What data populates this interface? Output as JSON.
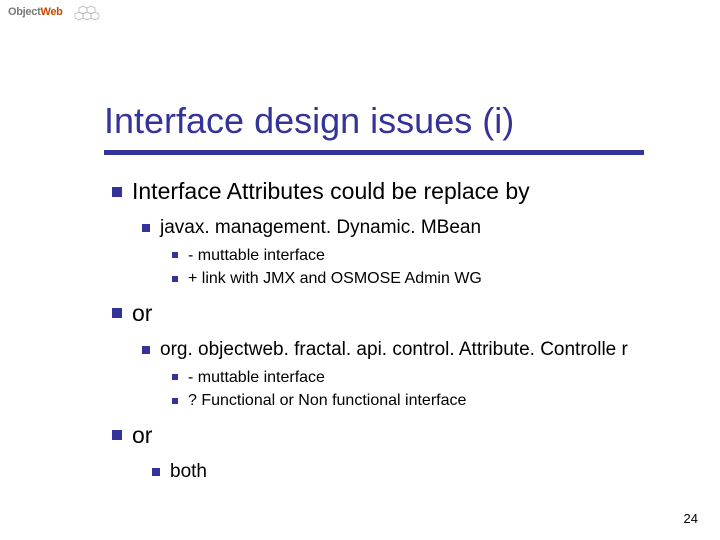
{
  "logo": {
    "part1": "Object",
    "part2": "Web"
  },
  "title": "Interface design issues (i)",
  "bullets": {
    "l1a": "Interface Attributes could be replace by",
    "l2a": "javax. management. Dynamic. MBean",
    "l3a": "- muttable interface",
    "l3b": "+ link with JMX and OSMOSE Admin WG",
    "l1b": "or",
    "l2b": "org. objectweb. fractal. api. control. Attribute. Controlle r",
    "l3c": "- muttable interface",
    "l3d": "? Functional or Non functional interface",
    "l1c": "or",
    "l2c": "both"
  },
  "slide_number": "24"
}
